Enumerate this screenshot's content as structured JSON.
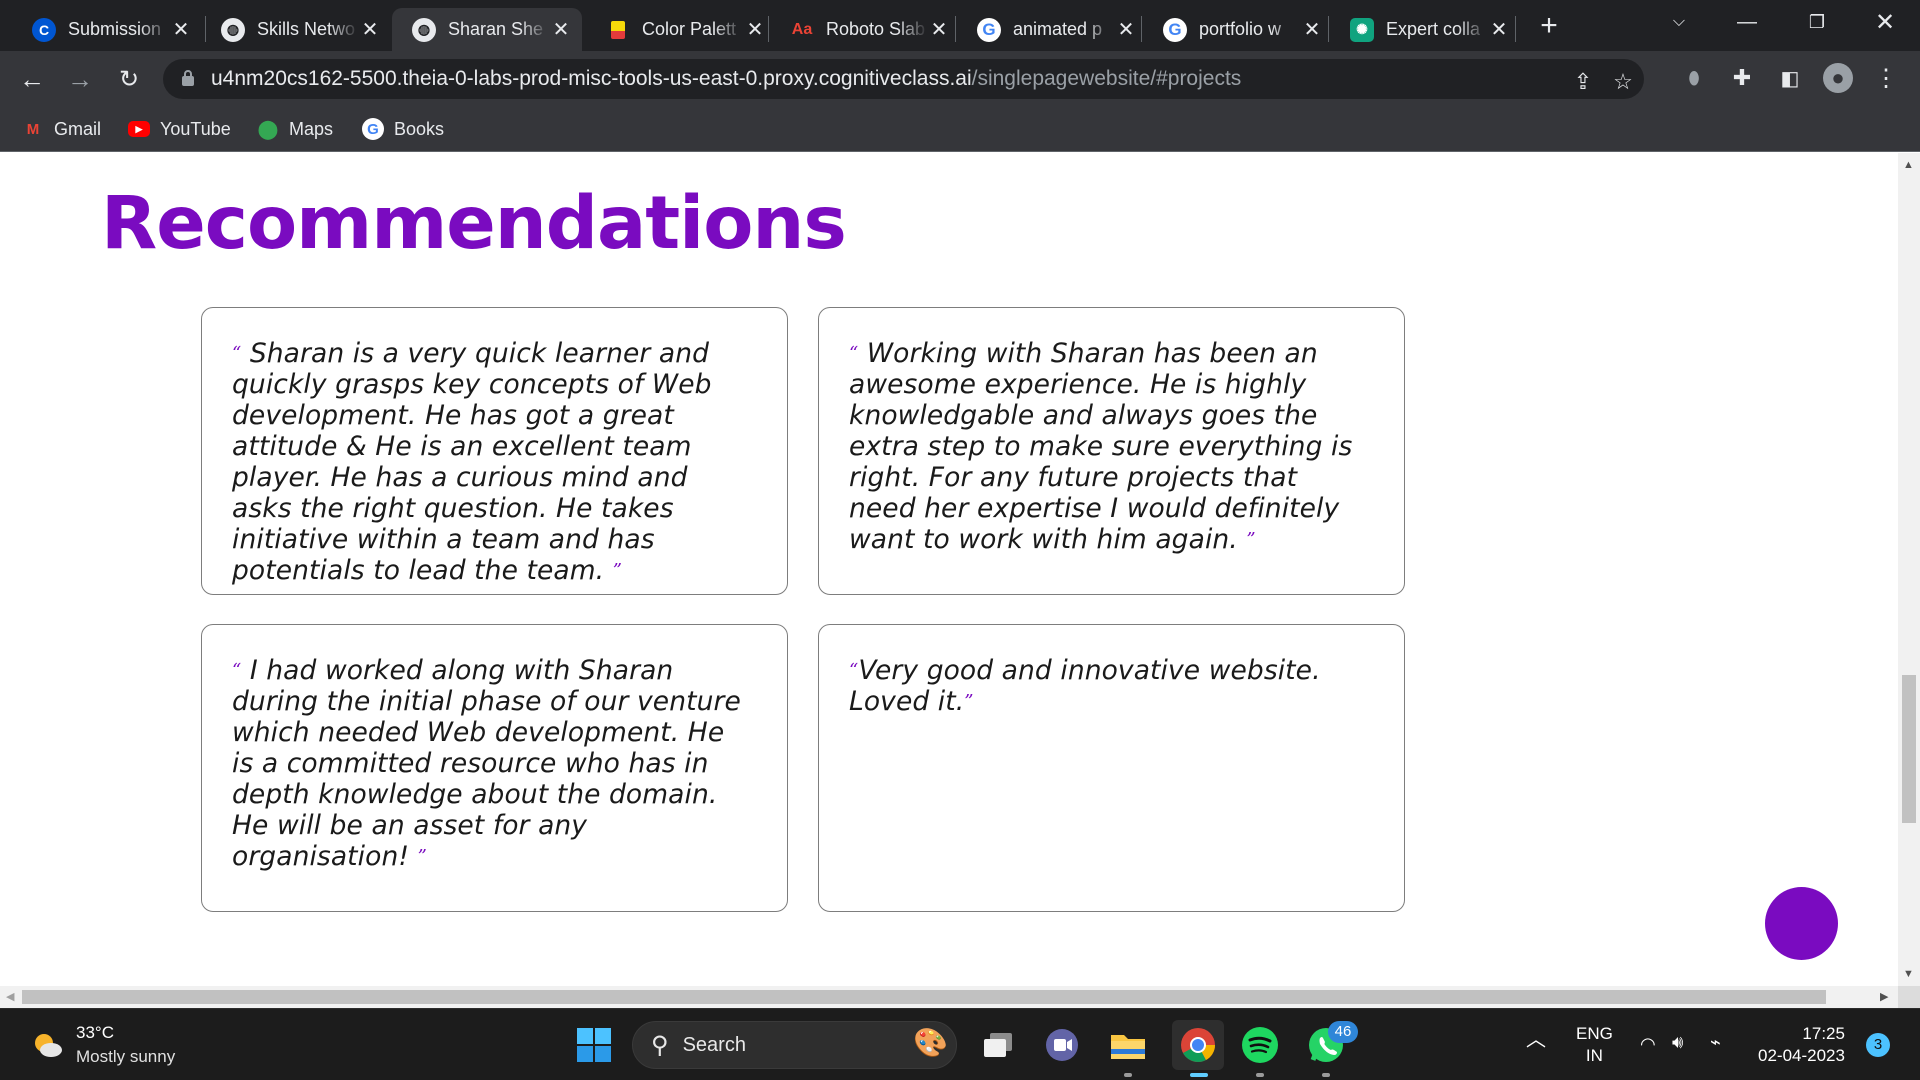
{
  "browser": {
    "tabs": [
      {
        "title": "Submission",
        "favicon": "coursera-c-icon",
        "active": false
      },
      {
        "title": "Skills Netwo",
        "favicon": "globe-icon",
        "active": false
      },
      {
        "title": "Sharan She",
        "favicon": "globe-icon",
        "active": true
      },
      {
        "title": "Color Palett",
        "favicon": "palette-icon",
        "active": false
      },
      {
        "title": "Roboto Slab",
        "favicon": "google-fonts-icon",
        "active": false
      },
      {
        "title": "animated p",
        "favicon": "google-g-icon",
        "active": false
      },
      {
        "title": "portfolio w",
        "favicon": "google-g-icon",
        "active": false
      },
      {
        "title": "Expert colla",
        "favicon": "chatgpt-icon",
        "active": false
      }
    ],
    "url_host": "u4nm20cs162-5500.theia-0-labs-prod-misc-tools-us-east-0.proxy.cognitiveclass.ai",
    "url_path": "/singlepagewebsite/#projects",
    "bookmarks": [
      {
        "label": "Gmail",
        "icon": "gmail-icon"
      },
      {
        "label": "YouTube",
        "icon": "youtube-icon"
      },
      {
        "label": "Maps",
        "icon": "maps-icon"
      },
      {
        "label": "Books",
        "icon": "google-g-icon"
      }
    ]
  },
  "page": {
    "heading": "Recommendations",
    "recommendations": [
      {
        "open": "“",
        "text": " Sharan is a very quick learner and quickly grasps key concepts of Web development. He has got a great attitude & He is an excellent team player. He has a curious mind and asks the right question. He takes initiative within a team and has potentials to lead the team. ",
        "close": "”"
      },
      {
        "open": "“",
        "text": " Working with Sharan has been an awesome experience. He is highly knowledgable and always goes the extra step to make sure everything is right. For any future projects that need her expertise I would definitely want to work with him again. ",
        "close": "”"
      },
      {
        "open": "“",
        "text": " I had worked along with Sharan during the initial phase of our venture which needed Web development. He is a committed resource who has in depth knowledge about the domain. He will be an asset for any organisation! ",
        "close": "”"
      },
      {
        "open": "“",
        "text": "Very good and innovative website. Loved it.",
        "close": "”"
      }
    ],
    "accent_color": "#7a0bc0"
  },
  "taskbar": {
    "weather_temp": "33°C",
    "weather_desc": "Mostly sunny",
    "search_label": "Search",
    "whatsapp_badge": "46",
    "lang_top": "ENG",
    "lang_bottom": "IN",
    "time": "17:25",
    "date": "02-04-2023",
    "notification_count": "3"
  }
}
